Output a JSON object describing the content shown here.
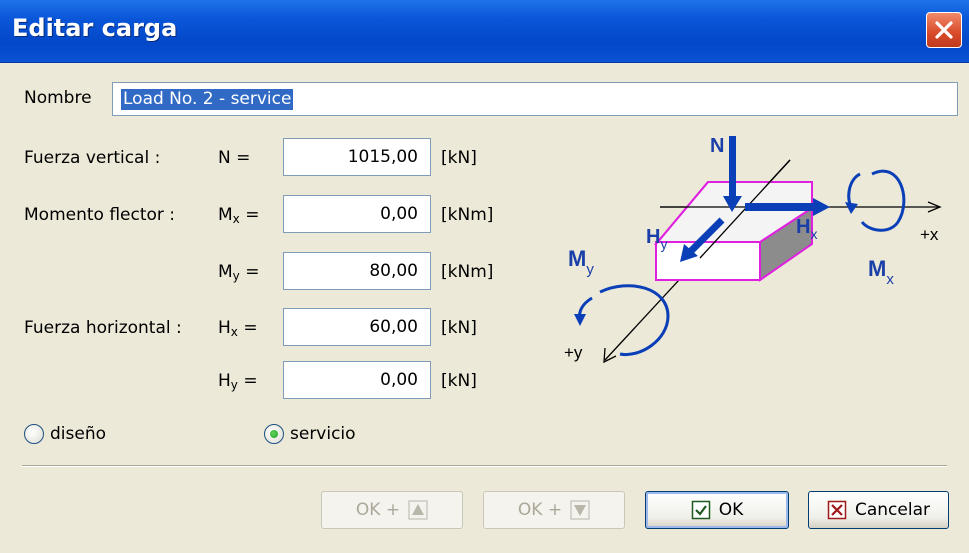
{
  "window": {
    "title": "Editar carga",
    "close_glyph": "✕"
  },
  "form": {
    "name_label": "Nombre",
    "name_value": "Load No. 2 - service",
    "rows": [
      {
        "group_label": "Fuerza vertical :",
        "symbol": "N",
        "sub": "",
        "eq": "=",
        "value": "1015,00",
        "unit": "[kN]"
      },
      {
        "group_label": "Momento flector :",
        "symbol": "M",
        "sub": "x",
        "eq": "=",
        "value": "0,00",
        "unit": "[kNm]"
      },
      {
        "group_label": "",
        "symbol": "M",
        "sub": "y",
        "eq": "=",
        "value": "80,00",
        "unit": "[kNm]"
      },
      {
        "group_label": "Fuerza horizontal :",
        "symbol": "H",
        "sub": "x",
        "eq": "=",
        "value": "60,00",
        "unit": "[kN]"
      },
      {
        "group_label": "",
        "symbol": "H",
        "sub": "y",
        "eq": "=",
        "value": "0,00",
        "unit": "[kN]"
      }
    ]
  },
  "load_type": {
    "options": [
      {
        "label": "diseño",
        "selected": false
      },
      {
        "label": "servicio",
        "selected": true
      }
    ]
  },
  "diagram": {
    "label_N": "N",
    "label_Hy_main": "H",
    "label_Hy_sub": "y",
    "label_Hx_main": "H",
    "label_Hx_sub": "x",
    "label_My_main": "M",
    "label_My_sub": "y",
    "label_Mx_main": "M",
    "label_Mx_sub": "x",
    "label_plus_x": "+x",
    "label_plus_y": "+y",
    "colors": {
      "arrow": "#0a3fb8",
      "box_edge": "#e020e0",
      "box_side": "#8c8c8c",
      "text": "#1b3fa8"
    }
  },
  "buttons": {
    "ok_plus_up": "OK +",
    "ok_plus_down": "OK +",
    "ok": "OK",
    "cancel": "Cancelar"
  },
  "colors": {
    "title_bar": "#0a56d8",
    "dialog_bg": "#ece9d8",
    "selection": "#316ac5",
    "close_button": "#d8492a"
  }
}
